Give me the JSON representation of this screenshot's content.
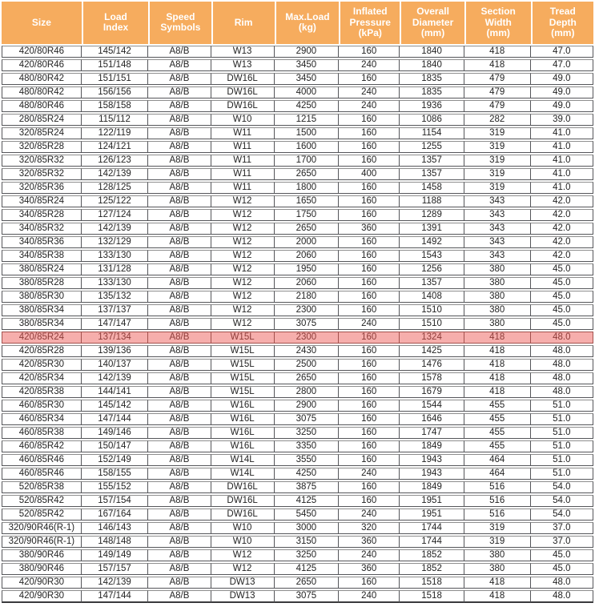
{
  "table": {
    "columns": [
      {
        "id": "size",
        "label": "Size"
      },
      {
        "id": "load-index",
        "label": "Load\nIndex"
      },
      {
        "id": "speed-symbols",
        "label": "Speed\nSymbols"
      },
      {
        "id": "rim",
        "label": "Rim"
      },
      {
        "id": "max-load",
        "label": "Max.Load\n(kg)"
      },
      {
        "id": "inflated-pressure",
        "label": "Inflated\nPressure\n(kPa)"
      },
      {
        "id": "overall-diameter",
        "label": "Overall\nDiameter\n(mm)"
      },
      {
        "id": "section-width",
        "label": "Section\nWidth\n(mm)"
      },
      {
        "id": "tread-depth",
        "label": "Tread\nDepth\n(mm)"
      }
    ],
    "highlighted_row_index": 21,
    "rows": [
      [
        "420/80R46",
        "145/142",
        "A8/B",
        "W13",
        "2900",
        "160",
        "1840",
        "418",
        "47.0"
      ],
      [
        "420/80R46",
        "151/148",
        "A8/B",
        "W13",
        "3450",
        "240",
        "1840",
        "418",
        "47.0"
      ],
      [
        "480/80R42",
        "151/151",
        "A8/B",
        "DW16L",
        "3450",
        "160",
        "1835",
        "479",
        "49.0"
      ],
      [
        "480/80R42",
        "156/156",
        "A8/B",
        "DW16L",
        "4000",
        "240",
        "1835",
        "479",
        "49.0"
      ],
      [
        "480/80R46",
        "158/158",
        "A8/B",
        "DW16L",
        "4250",
        "240",
        "1936",
        "479",
        "49.0"
      ],
      [
        "280/85R24",
        "115/112",
        "A8/B",
        "W10",
        "1215",
        "160",
        "1086",
        "282",
        "39.0"
      ],
      [
        "320/85R24",
        "122/119",
        "A8/B",
        "W11",
        "1500",
        "160",
        "1154",
        "319",
        "41.0"
      ],
      [
        "320/85R28",
        "124/121",
        "A8/B",
        "W11",
        "1600",
        "160",
        "1255",
        "319",
        "41.0"
      ],
      [
        "320/85R32",
        "126/123",
        "A8/B",
        "W11",
        "1700",
        "160",
        "1357",
        "319",
        "41.0"
      ],
      [
        "320/85R32",
        "142/139",
        "A8/B",
        "W11",
        "2650",
        "400",
        "1357",
        "319",
        "41.0"
      ],
      [
        "320/85R36",
        "128/125",
        "A8/B",
        "W11",
        "1800",
        "160",
        "1458",
        "319",
        "41.0"
      ],
      [
        "340/85R24",
        "125/122",
        "A8/B",
        "W12",
        "1650",
        "160",
        "1188",
        "343",
        "42.0"
      ],
      [
        "340/85R28",
        "127/124",
        "A8/B",
        "W12",
        "1750",
        "160",
        "1289",
        "343",
        "42.0"
      ],
      [
        "340/85R32",
        "142/139",
        "A8/B",
        "W12",
        "2650",
        "360",
        "1391",
        "343",
        "42.0"
      ],
      [
        "340/85R36",
        "132/129",
        "A8/B",
        "W12",
        "2000",
        "160",
        "1492",
        "343",
        "42.0"
      ],
      [
        "340/85R38",
        "133/130",
        "A8/B",
        "W12",
        "2060",
        "160",
        "1543",
        "343",
        "42.0"
      ],
      [
        "380/85R24",
        "131/128",
        "A8/B",
        "W12",
        "1950",
        "160",
        "1256",
        "380",
        "45.0"
      ],
      [
        "380/85R28",
        "133/130",
        "A8/B",
        "W12",
        "2060",
        "160",
        "1357",
        "380",
        "45.0"
      ],
      [
        "380/85R30",
        "135/132",
        "A8/B",
        "W12",
        "2180",
        "160",
        "1408",
        "380",
        "45.0"
      ],
      [
        "380/85R34",
        "137/137",
        "A8/B",
        "W12",
        "2300",
        "160",
        "1510",
        "380",
        "45.0"
      ],
      [
        "380/85R34",
        "147/147",
        "A8/B",
        "W12",
        "3075",
        "240",
        "1510",
        "380",
        "45.0"
      ],
      [
        "420/85R24",
        "137/134",
        "A8/B",
        "W15L",
        "2300",
        "160",
        "1324",
        "418",
        "48.0"
      ],
      [
        "420/85R28",
        "139/136",
        "A8/B",
        "W15L",
        "2430",
        "160",
        "1425",
        "418",
        "48.0"
      ],
      [
        "420/85R30",
        "140/137",
        "A8/B",
        "W15L",
        "2500",
        "160",
        "1476",
        "418",
        "48.0"
      ],
      [
        "420/85R34",
        "142/139",
        "A8/B",
        "W15L",
        "2650",
        "160",
        "1578",
        "418",
        "48.0"
      ],
      [
        "420/85R38",
        "144/141",
        "A8/B",
        "W15L",
        "2800",
        "160",
        "1679",
        "418",
        "48.0"
      ],
      [
        "460/85R30",
        "145/142",
        "A8/B",
        "W16L",
        "2900",
        "160",
        "1544",
        "455",
        "51.0"
      ],
      [
        "460/85R34",
        "147/144",
        "A8/B",
        "W16L",
        "3075",
        "160",
        "1646",
        "455",
        "51.0"
      ],
      [
        "460/85R38",
        "149/146",
        "A8/B",
        "W16L",
        "3250",
        "160",
        "1747",
        "455",
        "51.0"
      ],
      [
        "460/85R42",
        "150/147",
        "A8/B",
        "W16L",
        "3350",
        "160",
        "1849",
        "455",
        "51.0"
      ],
      [
        "460/85R46",
        "152/149",
        "A8/B",
        "W14L",
        "3550",
        "160",
        "1943",
        "464",
        "51.0"
      ],
      [
        "460/85R46",
        "158/155",
        "A8/B",
        "W14L",
        "4250",
        "240",
        "1943",
        "464",
        "51.0"
      ],
      [
        "520/85R38",
        "155/152",
        "A8/B",
        "DW16L",
        "3875",
        "160",
        "1849",
        "516",
        "54.0"
      ],
      [
        "520/85R42",
        "157/154",
        "A8/B",
        "DW16L",
        "4125",
        "160",
        "1951",
        "516",
        "54.0"
      ],
      [
        "520/85R42",
        "167/164",
        "A8/B",
        "DW16L",
        "5450",
        "240",
        "1951",
        "516",
        "54.0"
      ],
      [
        "320/90R46(R-1)",
        "146/143",
        "A8/B",
        "W10",
        "3000",
        "320",
        "1744",
        "319",
        "37.0"
      ],
      [
        "320/90R46(R-1)",
        "148/148",
        "A8/B",
        "W10",
        "3150",
        "360",
        "1744",
        "319",
        "37.0"
      ],
      [
        "380/90R46",
        "149/149",
        "A8/B",
        "W12",
        "3250",
        "240",
        "1852",
        "380",
        "45.0"
      ],
      [
        "380/90R46",
        "157/157",
        "A8/B",
        "W12",
        "4125",
        "360",
        "1852",
        "380",
        "45.0"
      ],
      [
        "420/90R30",
        "142/139",
        "A8/B",
        "DW13",
        "2650",
        "160",
        "1518",
        "418",
        "48.0"
      ],
      [
        "420/90R30",
        "147/144",
        "A8/B",
        "DW13",
        "3075",
        "240",
        "1518",
        "418",
        "48.0"
      ]
    ],
    "colors": {
      "header_background": "#F6AC5E",
      "header_text": "#FFFFFF",
      "body_text": "#232323",
      "highlight_background": "#F6AEAC",
      "highlight_text": "#8E3D3A"
    }
  }
}
